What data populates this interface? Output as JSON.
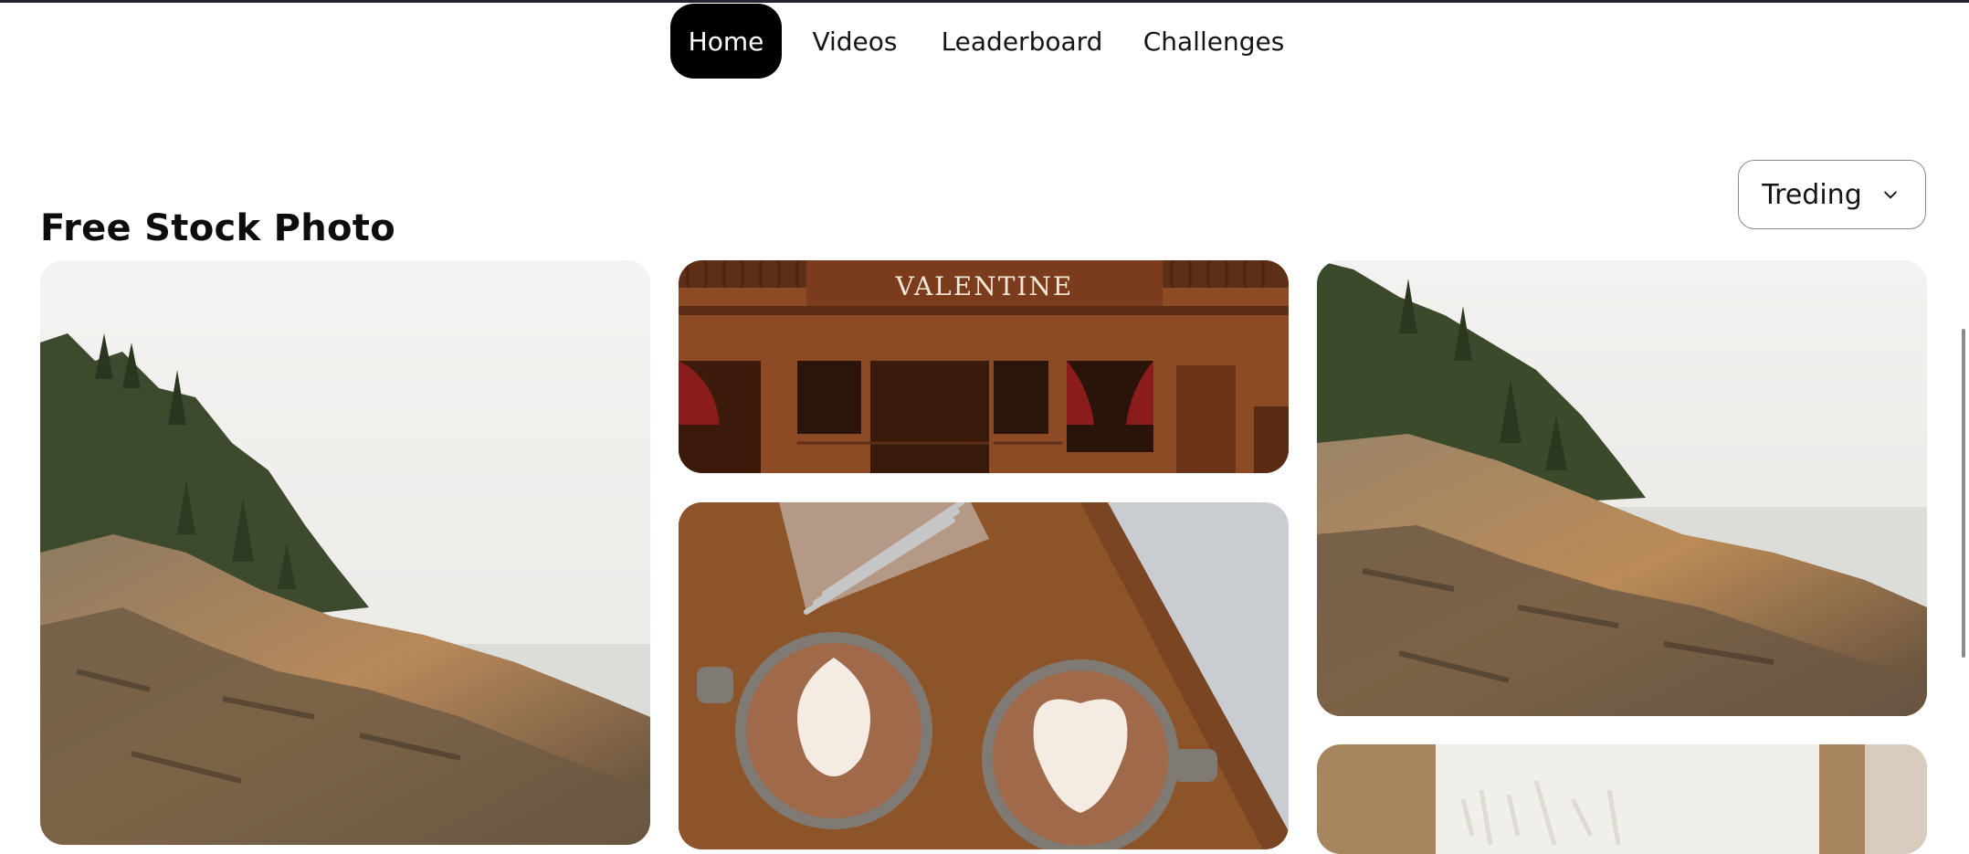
{
  "nav": {
    "items": [
      {
        "label": "Home",
        "active": true
      },
      {
        "label": "Videos",
        "active": false
      },
      {
        "label": "Leaderboard",
        "active": false
      },
      {
        "label": "Challenges",
        "active": false
      }
    ]
  },
  "section": {
    "title": "Free Stock Photo"
  },
  "sort": {
    "selected": "Treding",
    "icon": "chevron-down-icon"
  },
  "photos": [
    {
      "subject": "rocky-coastline-pines"
    },
    {
      "subject": "wooden-saloon-facade",
      "sign_text": "VALENTINE"
    },
    {
      "subject": "two-latte-cups-on-wooden-tray"
    },
    {
      "subject": "rocky-coastline-pines"
    },
    {
      "subject": "white-textured-canvas"
    }
  ],
  "colors": {
    "nav_active_bg": "#000000",
    "nav_active_text": "#ffffff",
    "text": "#111111",
    "dropdown_border": "#8a8a8a"
  }
}
